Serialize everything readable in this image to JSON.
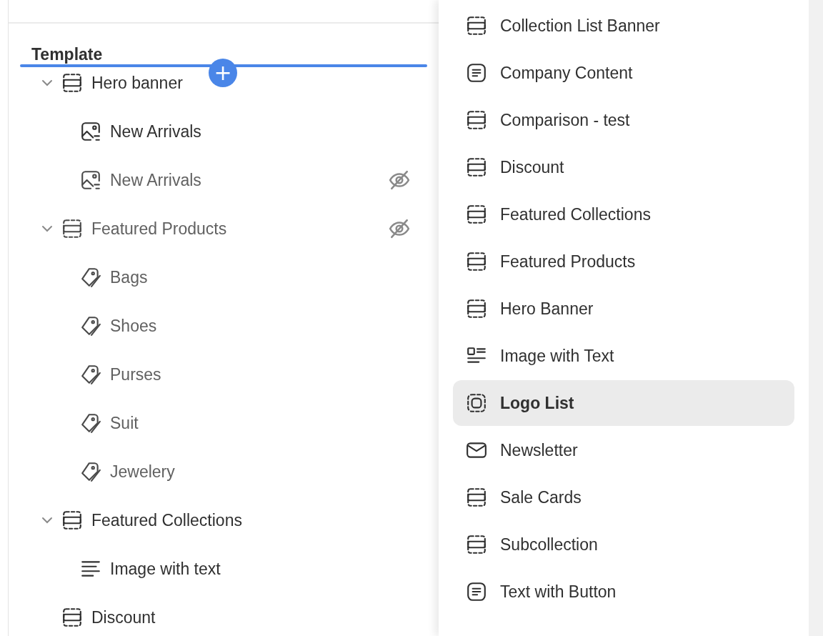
{
  "panel": {
    "heading": "Template",
    "insert_button": "+",
    "tree": [
      {
        "label": "Hero banner",
        "kind": "section",
        "expanded": true,
        "hidden": false,
        "children": [
          {
            "label": "New Arrivals",
            "kind": "image",
            "hidden": false
          },
          {
            "label": "New Arrivals",
            "kind": "image",
            "hidden": true
          }
        ]
      },
      {
        "label": "Featured Products",
        "kind": "section",
        "expanded": true,
        "hidden": true,
        "children": [
          {
            "label": "Bags",
            "kind": "tag",
            "hidden": false
          },
          {
            "label": "Shoes",
            "kind": "tag",
            "hidden": false
          },
          {
            "label": "Purses",
            "kind": "tag",
            "hidden": false
          },
          {
            "label": "Suit",
            "kind": "tag",
            "hidden": false
          },
          {
            "label": "Jewelery",
            "kind": "tag",
            "hidden": false
          }
        ]
      },
      {
        "label": "Featured Collections",
        "kind": "section",
        "expanded": true,
        "hidden": false,
        "children": [
          {
            "label": "Image with text",
            "kind": "lines",
            "hidden": false
          }
        ]
      },
      {
        "label": "Discount",
        "kind": "section",
        "hidden": false
      }
    ]
  },
  "menu": {
    "items": [
      {
        "label": "Collection List Banner",
        "kind": "section",
        "selected": false
      },
      {
        "label": "Company Content",
        "kind": "text",
        "selected": false
      },
      {
        "label": "Comparison - test",
        "kind": "section",
        "selected": false
      },
      {
        "label": "Discount",
        "kind": "section",
        "selected": false
      },
      {
        "label": "Featured Collections",
        "kind": "section",
        "selected": false
      },
      {
        "label": "Featured Products",
        "kind": "section",
        "selected": false
      },
      {
        "label": "Hero Banner",
        "kind": "section",
        "selected": false
      },
      {
        "label": "Image with Text",
        "kind": "image-text",
        "selected": false
      },
      {
        "label": "Logo List",
        "kind": "logo",
        "selected": true
      },
      {
        "label": "Newsletter",
        "kind": "mail",
        "selected": false
      },
      {
        "label": "Sale Cards",
        "kind": "section",
        "selected": false
      },
      {
        "label": "Subcollection",
        "kind": "section",
        "selected": false
      },
      {
        "label": "Text with Button",
        "kind": "text",
        "selected": false
      }
    ]
  }
}
